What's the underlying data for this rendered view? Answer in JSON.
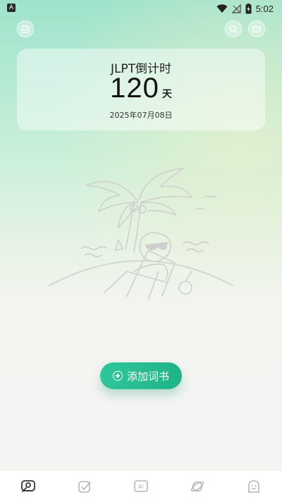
{
  "status_bar": {
    "app_icon_letter": "A",
    "time": "5:02",
    "icons": [
      "wifi-icon",
      "signal-off-icon",
      "battery-charging-icon"
    ]
  },
  "top_actions": {
    "left": "calendar-icon",
    "right": [
      "search-icon",
      "mail-icon"
    ]
  },
  "countdown": {
    "title": "JLPT倒计时",
    "days": "120",
    "unit": "天",
    "date": "2025年07月08日"
  },
  "illustration": "beach-relax-illustration",
  "add_button": {
    "label": "添加词书",
    "icon": "plus-circle-icon"
  },
  "bottom_nav": {
    "items": [
      {
        "icon": "wordbook-icon",
        "active": true
      },
      {
        "icon": "checkin-icon",
        "active": false
      },
      {
        "icon": "ai-icon",
        "label": "Ai",
        "active": false
      },
      {
        "icon": "planet-icon",
        "active": false
      },
      {
        "icon": "profile-ghost-icon",
        "active": false
      }
    ]
  },
  "colors": {
    "accent": "#22b98a",
    "header_gradient_top": "#9fe3cc",
    "background": "#f4f4f2",
    "nav_active": "#333333",
    "nav_inactive": "#b5b5b5"
  }
}
